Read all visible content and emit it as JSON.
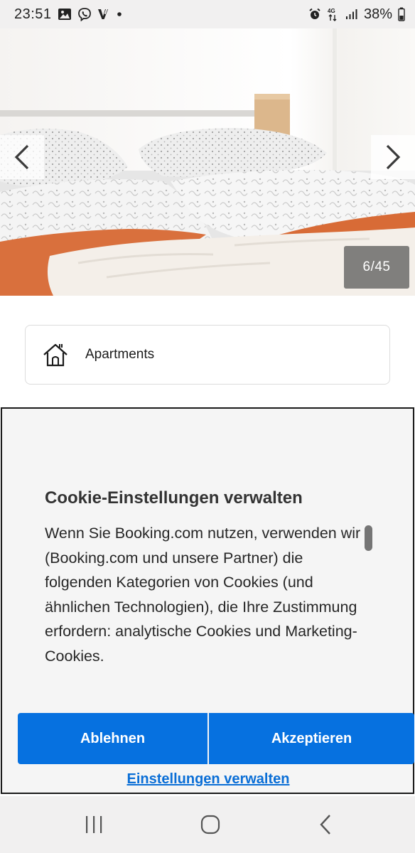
{
  "status_bar": {
    "time": "23:51",
    "left_icons": [
      "gallery-icon",
      "viber-icon",
      "v-app-icon",
      "notification-dot-icon"
    ],
    "right_icons": [
      "alarm-icon",
      "4g-data-icon",
      "signal-icon",
      "battery-icon"
    ],
    "network_label": "4G",
    "battery_percent": "38%"
  },
  "gallery": {
    "counter": "6/45",
    "prev_icon": "chevron-left-icon",
    "next_icon": "chevron-right-icon"
  },
  "property_type": {
    "icon": "house-icon",
    "label": "Apartments"
  },
  "cookie_dialog": {
    "title": "Cookie-Einstellungen verwalten",
    "body": "Wenn Sie Booking.com nutzen, verwenden wir (Booking.com und unsere Partner) die folgenden Kategorien von Cookies (und ähnlichen Technologien), die Ihre Zustimmung erfordern: analytische Cookies und Marketing-Cookies.",
    "reject_label": "Ablehnen",
    "accept_label": "Akzeptieren",
    "manage_label": "Einstellungen verwalten"
  },
  "nav_bar": {
    "icons": [
      "recent-apps-icon",
      "home-icon",
      "back-icon"
    ]
  },
  "colors": {
    "primary_button": "#0671e0",
    "link": "#0a6ed6",
    "dialog_background": "#f5f5f5",
    "system_bar": "#f1f0f0"
  }
}
